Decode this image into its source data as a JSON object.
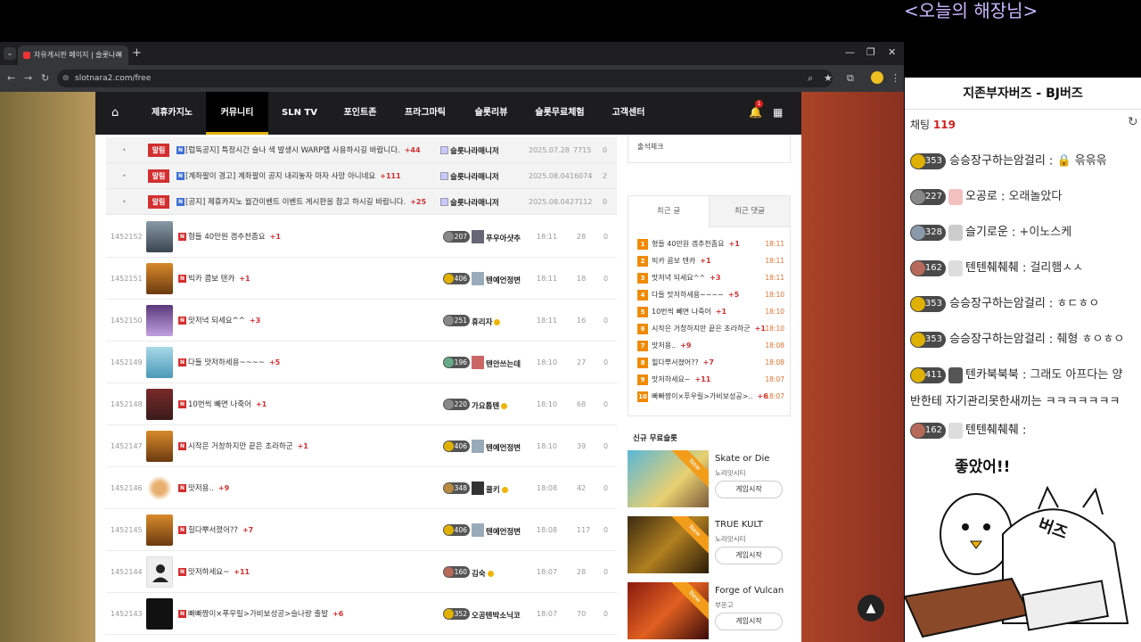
{
  "overlay_title": "<오늘의 해장님>",
  "browser": {
    "tab_title": "자유게시판 페이지 | 슬롯나라",
    "url": "slotnara2.com/free"
  },
  "nav": {
    "items": [
      "제휴카지노",
      "커뮤니티",
      "SLN TV",
      "포인트존",
      "프라그마틱",
      "슬롯리뷰",
      "슬롯무료체험",
      "고객센터"
    ],
    "notif_count": "1"
  },
  "notices": [
    {
      "tag": "알림",
      "title": "[럽독공지] 특정시간 슬나 색 발생시 WARP앱 사용하시길 바랍니다.",
      "comments": "+44",
      "author": "슬롯나라매니저",
      "date": "2025.07.28",
      "views": "7715",
      "likes": "0"
    },
    {
      "tag": "알림",
      "title": "[계좌팔이 경고] 계좌팔이 공지 내리놓자 마자 사망 아니네요",
      "comments": "+111",
      "author": "슬롯나라매니저",
      "date": "2025.08.04",
      "views": "16074",
      "likes": "2"
    },
    {
      "tag": "알림",
      "title": "[공지] 제휴카지노 월간이벤트 이벤트 게시판을 참고 하시길 바랍니다.",
      "comments": "+25",
      "author": "슬롯나라매니저",
      "date": "2025.08.04",
      "views": "27112",
      "likes": "0"
    }
  ],
  "posts": [
    {
      "num": "1452152",
      "title": "형들 40만원 겜추천좀요",
      "comments": "+1",
      "level": "207",
      "author": "푸우아샷추",
      "time": "18:11",
      "views": "28",
      "likes": "0",
      "verified": false
    },
    {
      "num": "1452151",
      "title": "빅카 콤보 텐카",
      "comments": "+1",
      "level": "406",
      "author": "텐예언정변",
      "time": "18:11",
      "views": "18",
      "likes": "0",
      "verified": false
    },
    {
      "num": "1452150",
      "title": "맛저녁 되세요^^",
      "comments": "+3",
      "level": "251",
      "author": "휴리자",
      "time": "18:11",
      "views": "16",
      "likes": "0",
      "verified": true
    },
    {
      "num": "1452149",
      "title": "다들 맛저하세용~~~~",
      "comments": "+5",
      "level": "196",
      "author": "텐안쓰는데",
      "time": "18:10",
      "views": "27",
      "likes": "0",
      "verified": false
    },
    {
      "num": "1452148",
      "title": "10번씩 빼면 나죽어",
      "comments": "+1",
      "level": "220",
      "author": "가요톱텐",
      "time": "18:10",
      "views": "68",
      "likes": "0",
      "verified": true
    },
    {
      "num": "1452147",
      "title": "시작은 거창하지만 끝은 초라하군",
      "comments": "+1",
      "level": "406",
      "author": "텐예언정변",
      "time": "18:10",
      "views": "39",
      "likes": "0",
      "verified": false
    },
    {
      "num": "1452146",
      "title": "맛저용..",
      "comments": "+9",
      "level": "348",
      "author": "쿨키",
      "time": "18:08",
      "views": "42",
      "likes": "0",
      "verified": true
    },
    {
      "num": "1452145",
      "title": "힐다뿌서졌어??",
      "comments": "+7",
      "level": "406",
      "author": "텐예언정변",
      "time": "18:08",
      "views": "117",
      "likes": "0",
      "verified": false
    },
    {
      "num": "1452144",
      "title": "맛저하세요~",
      "comments": "+11",
      "level": "160",
      "author": "김숙",
      "time": "18:07",
      "views": "28",
      "likes": "0",
      "verified": true
    },
    {
      "num": "1452143",
      "title": "빠빠짱이×푸우릴>가비보성공>슬나량 출발",
      "comments": "+6",
      "level": "352",
      "author": "오공텐박소닉코",
      "time": "18:07",
      "views": "70",
      "likes": "0",
      "verified": false
    }
  ],
  "sidebar": {
    "attendance": "출석체크",
    "tab_recent_posts": "최근 글",
    "tab_recent_comments": "최근 댓글",
    "recent": [
      {
        "rank": "1",
        "title": "형들 40만원 겜추천좀요",
        "comments": "+1",
        "time": "18:11"
      },
      {
        "rank": "2",
        "title": "빅카 콤보 텐카",
        "comments": "+1",
        "time": "18:11"
      },
      {
        "rank": "3",
        "title": "맛저녁 되세요^^",
        "comments": "+3",
        "time": "18:11"
      },
      {
        "rank": "4",
        "title": "다들 맛저하세용~~~~",
        "comments": "+5",
        "time": "18:10"
      },
      {
        "rank": "5",
        "title": "10번씩 빼면 나죽어",
        "comments": "+1",
        "time": "18:10"
      },
      {
        "rank": "6",
        "title": "시작은 거창하지만 끝은 초라하군",
        "comments": "+1",
        "time": "18:10"
      },
      {
        "rank": "7",
        "title": "맛저용..",
        "comments": "+9",
        "time": "18:08"
      },
      {
        "rank": "8",
        "title": "힐다뿌서졌어??",
        "comments": "+7",
        "time": "18:08"
      },
      {
        "rank": "9",
        "title": "맛저하세요~",
        "comments": "+11",
        "time": "18:07"
      },
      {
        "rank": "10",
        "title": "빠빠짱이×푸우릴>가비보성공>..",
        "comments": "+6",
        "time": "18:07"
      }
    ],
    "free_slots_title": "신규 무료슬롯",
    "games": [
      {
        "name": "Skate or Die",
        "provider": "노리밋시티",
        "button": "게임시작",
        "ribbon": "New"
      },
      {
        "name": "TRUE KULT",
        "provider": "노리밋시티",
        "button": "게임시작",
        "ribbon": "New"
      },
      {
        "name": "Forge of Vulcan",
        "provider": "부운고",
        "button": "게임시작",
        "ribbon": "New"
      }
    ]
  },
  "chat": {
    "title": "지존부자버즈 - BJ버즈",
    "count_label": "채팅",
    "count": "119",
    "messages": [
      {
        "level": "353",
        "nick": "승승장구하는암걸리",
        "text": "🔒 윾윾윾"
      },
      {
        "level": "227",
        "nick": "오공로",
        "text": "오래놀았다"
      },
      {
        "level": "328",
        "nick": "슬기로운",
        "text": "+이노스케"
      },
      {
        "level": "162",
        "nick": "텐텐췌췌췌",
        "text": "걸리햄ㅅㅅ"
      },
      {
        "level": "353",
        "nick": "승승장구하는암걸리",
        "text": "ㅎㄷㅎㅇ"
      },
      {
        "level": "353",
        "nick": "승승장구하는암걸리",
        "text": "췌형 ㅎㅇㅎㅇ"
      },
      {
        "level": "411",
        "nick": "텐카북북북",
        "text": "그래도 아프다는 양"
      },
      {
        "level": "162",
        "nick": "텐텐췌췌췌",
        "text": ""
      }
    ],
    "wrap_line": "반한테 자기관리못한새끼는 ㅋㅋㅋㅋㅋㅋㅋ",
    "sticker_text": "좋았어!!",
    "sticker_caption": "버즈"
  },
  "colors": {
    "notice_red": "#d32f2f",
    "new_blue": "#3b6fd6",
    "rank_orange": "#f08a00",
    "nav_bg": "#1d1d1f",
    "active_underline": "#e0b000"
  },
  "icons": [
    "home-icon",
    "bell-icon",
    "grid-icon",
    "scroll-top-icon",
    "refresh-icon",
    "lock-icon"
  ]
}
